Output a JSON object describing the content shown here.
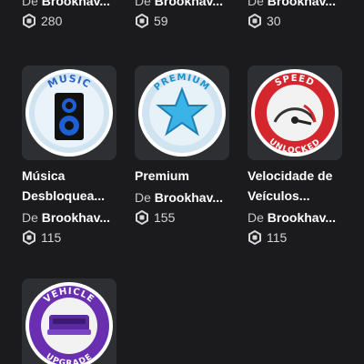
{
  "top_row": [
    {
      "creator_prefix": "De",
      "creator": "Brookhav...",
      "price": "280"
    },
    {
      "creator_prefix": "De",
      "creator": "Brookhav...",
      "price": "59"
    },
    {
      "creator_prefix": "De",
      "creator": "Brookhav...",
      "price": "30"
    }
  ],
  "items": [
    {
      "icon": "music-speaker-badge",
      "badge_text": "MUSIC",
      "title_line1": "Música",
      "title_line2": "Desbloquea...",
      "creator_prefix": "De",
      "creator": "Brookhav...",
      "price": "115"
    },
    {
      "icon": "premium-star-badge",
      "badge_text": "PREMIUM",
      "title_line1": "Premium",
      "title_line2": "",
      "creator_prefix": "De",
      "creator": "Brookhav...",
      "price": "155"
    },
    {
      "icon": "speed-unlocked-badge",
      "badge_text_top": "SPEED",
      "badge_text_bottom": "UNLOCKED",
      "title_line1": "Velocidade de",
      "title_line2": "Veículos...",
      "creator_prefix": "De",
      "creator": "Brookhav...",
      "price": "115"
    },
    {
      "icon": "vehicle-upgrade-badge",
      "badge_text_top": "VEHICLE",
      "badge_text_bottom": "UPGRADE"
    }
  ],
  "colors": {
    "background": "#1b1b1d",
    "card": "#2e2f32",
    "robux_icon": "#d6d6d6"
  }
}
